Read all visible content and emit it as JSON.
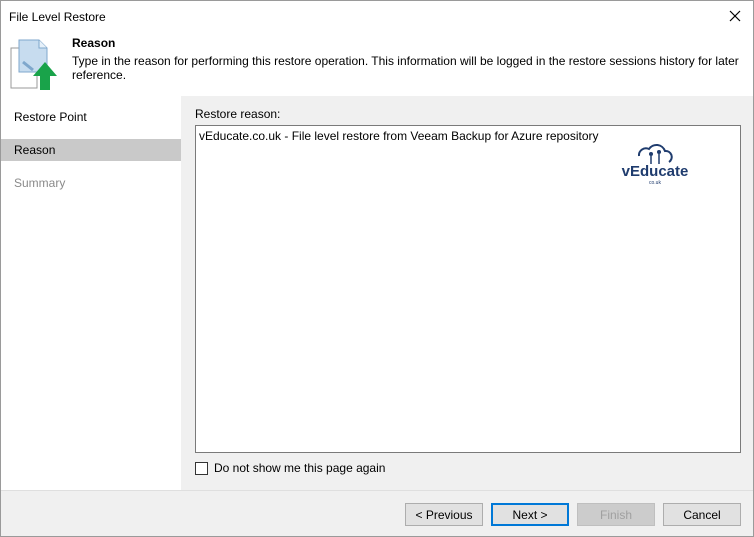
{
  "window": {
    "title": "File Level Restore"
  },
  "header": {
    "title": "Reason",
    "description": "Type in the reason for performing this restore operation. This information will be logged in the restore sessions history for later reference."
  },
  "sidebar": {
    "items": [
      {
        "label": "Restore Point",
        "state": "normal"
      },
      {
        "label": "Reason",
        "state": "active"
      },
      {
        "label": "Summary",
        "state": "disabled"
      }
    ]
  },
  "content": {
    "field_label": "Restore reason:",
    "reason_value": "vEducate.co.uk - File level restore from Veeam Backup for Azure repository",
    "logo_text": "vEducate",
    "logo_subtext": "co.uk",
    "checkbox_label": "Do not show me this page again",
    "checkbox_checked": false
  },
  "footer": {
    "previous_label": "< Previous",
    "next_label": "Next >",
    "finish_label": "Finish",
    "cancel_label": "Cancel"
  },
  "colors": {
    "accent": "#0078d7",
    "active_nav": "#c9c9c9",
    "arrow_green": "#19a34a",
    "logo_navy": "#1f3c6e"
  }
}
